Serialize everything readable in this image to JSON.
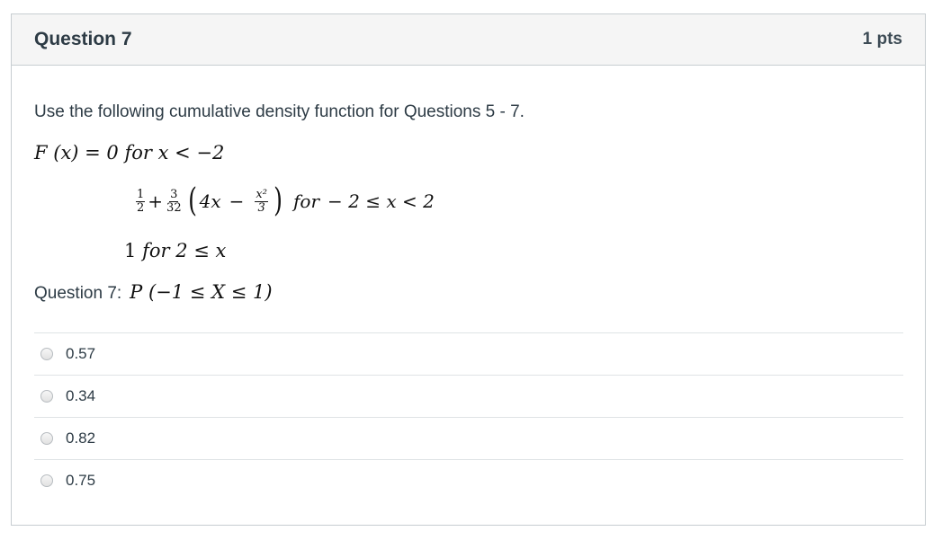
{
  "question": {
    "title": "Question 7",
    "points": "1 pts",
    "intro": "Use the following cumulative density function for Questions 5 - 7.",
    "prompt_label": "Question 7:",
    "prompt_math": "P (−1 ≤ X ≤ 1)"
  },
  "cdf": {
    "line1_lhs": "F (x) = 0",
    "line1_for": "for",
    "line1_cond": "x < −2",
    "line2_frac1_num": "1",
    "line2_frac1_den": "2",
    "line2_plus": "+",
    "line2_frac2_num": "3",
    "line2_frac2_den": "32",
    "line2_inner": "4x",
    "line2_minus": "−",
    "line2_frac3_num": "x²",
    "line2_frac3_den": "3",
    "line2_for": "for",
    "line2_cond": "− 2 ≤ x < 2",
    "line3_val": "1",
    "line3_for": "for",
    "line3_cond": "2 ≤ x"
  },
  "answers": [
    {
      "label": "0.57"
    },
    {
      "label": "0.34"
    },
    {
      "label": "0.82"
    },
    {
      "label": "0.75"
    }
  ]
}
